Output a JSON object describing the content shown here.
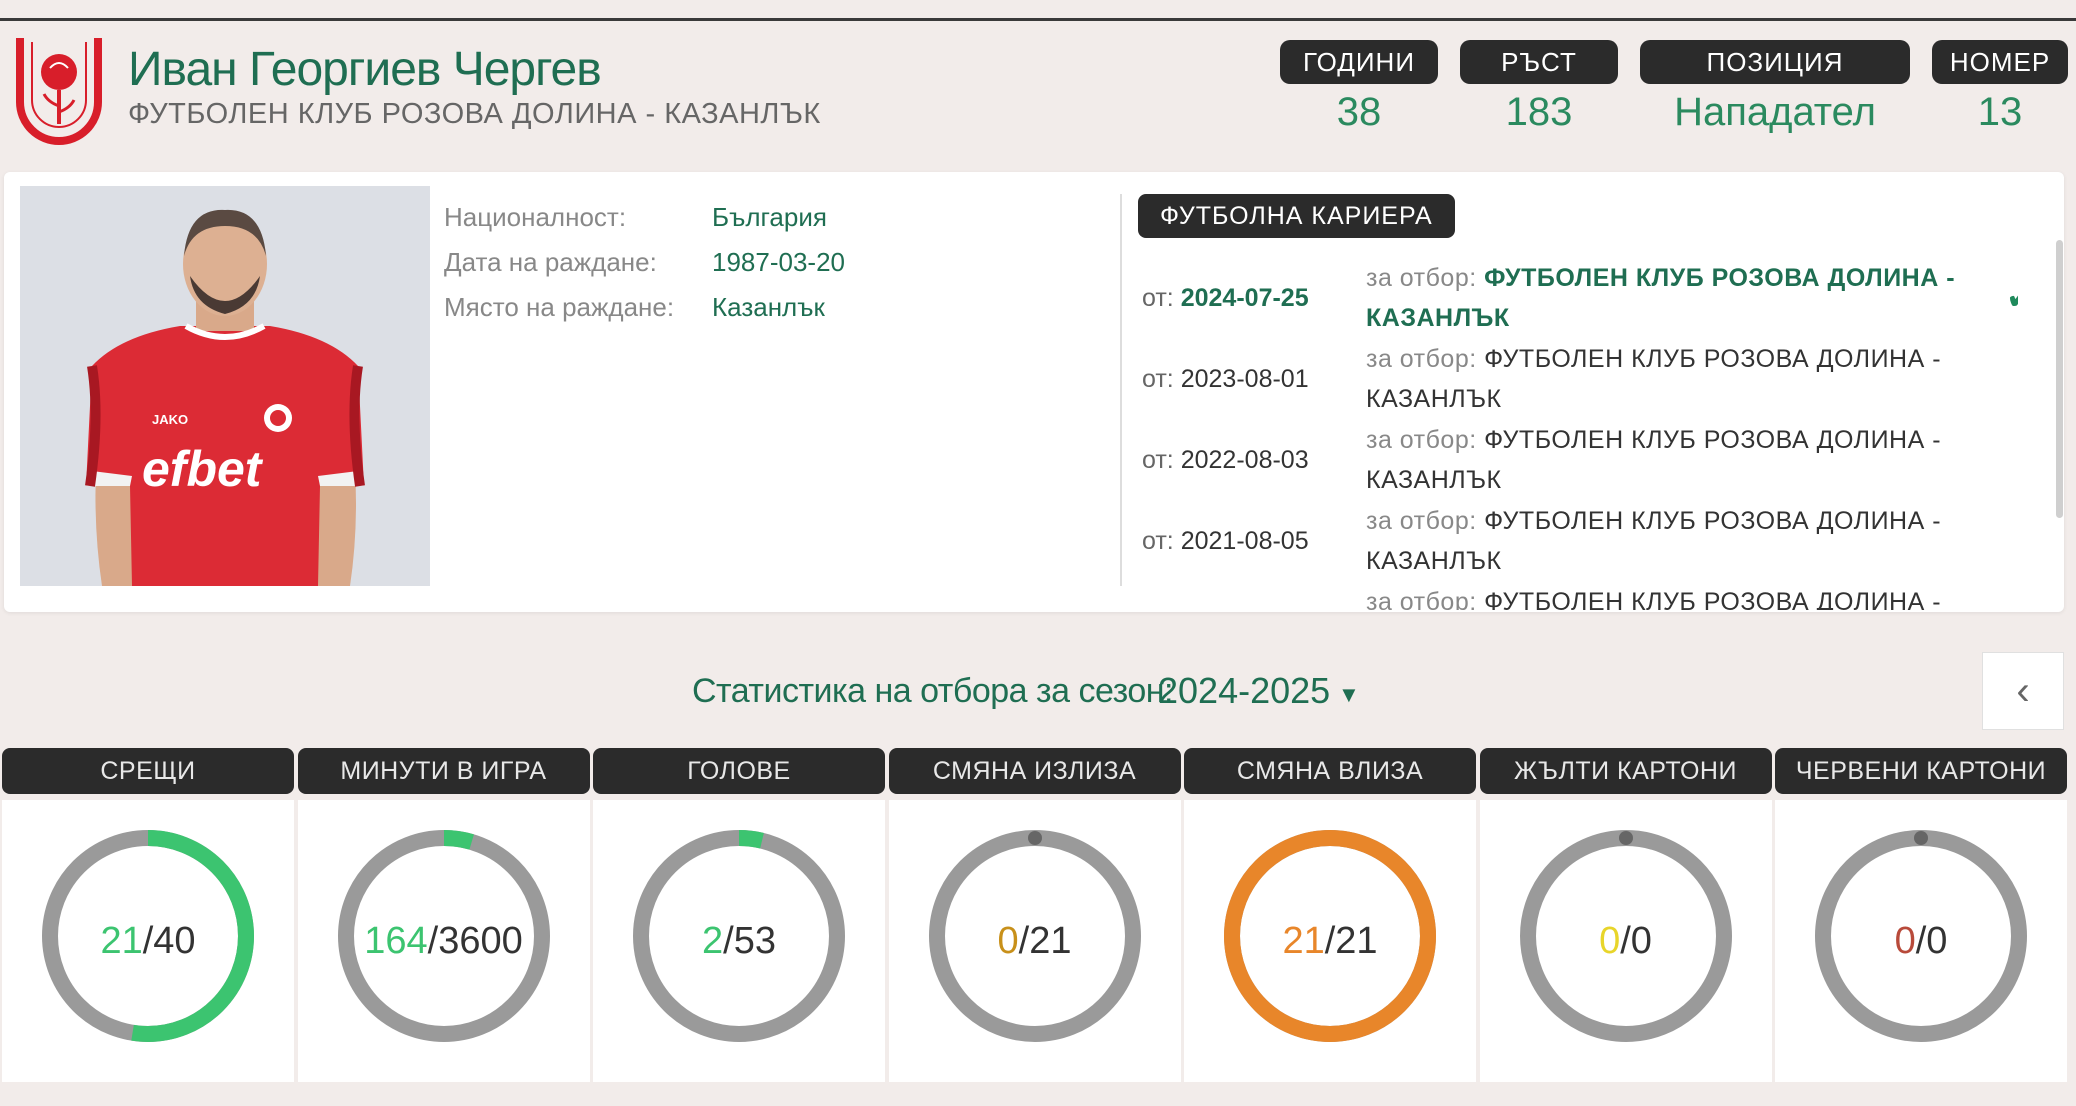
{
  "player": {
    "name": "Иван Георгиев Чергев",
    "club": "ФУТБОЛЕН КЛУБ РОЗОВА ДОЛИНА - КАЗАНЛЪК"
  },
  "info": [
    {
      "label": "ГОДИНИ",
      "value": "38"
    },
    {
      "label": "РЪСТ",
      "value": "183"
    },
    {
      "label": "ПОЗИЦИЯ",
      "value": "Нападател"
    },
    {
      "label": "НОМЕР",
      "value": "13"
    }
  ],
  "details": [
    {
      "label": "Националност:",
      "value": "България"
    },
    {
      "label": "Дата на раждане:",
      "value": "1987-03-20"
    },
    {
      "label": "Място на раждане:",
      "value": "Казанлък"
    }
  ],
  "photo": {
    "shirt_text": "efbet"
  },
  "career": {
    "title": "ФУТБОЛНА КАРИЕРА",
    "from_label": "от:",
    "team_label": "за отбор:",
    "entries": [
      {
        "date": "2024-07-25",
        "team": "ФУТБОЛЕН КЛУБ РОЗОВА ДОЛИНА - КАЗАНЛЪК",
        "current": true
      },
      {
        "date": "2023-08-01",
        "team": "ФУТБОЛЕН КЛУБ РОЗОВА ДОЛИНА - КАЗАНЛЪК",
        "current": false
      },
      {
        "date": "2022-08-03",
        "team": "ФУТБОЛЕН КЛУБ РОЗОВА ДОЛИНА - КАЗАНЛЪК",
        "current": false
      },
      {
        "date": "2021-08-05",
        "team": "ФУТБОЛЕН КЛУБ РОЗОВА ДОЛИНА - КАЗАНЛЪК",
        "current": false
      },
      {
        "date": "",
        "team": "ФУТБОЛЕН КЛУБ РОЗОВА ДОЛИНА -",
        "current": false
      }
    ]
  },
  "season": {
    "label": "Статистика на отбора за сезон:",
    "value": "2024-2025"
  },
  "stats": [
    {
      "label": "СРЕЩИ",
      "value": 21,
      "total": 40,
      "color": "#3cc470"
    },
    {
      "label": "МИНУТИ В ИГРА",
      "value": 164,
      "total": 3600,
      "color": "#3cc470"
    },
    {
      "label": "ГОЛОВЕ",
      "value": 2,
      "total": 53,
      "color": "#3cc470"
    },
    {
      "label": "СМЯНА ИЗЛИЗА",
      "value": 0,
      "total": 21,
      "color": "#c8901a"
    },
    {
      "label": "СМЯНА ВЛИЗА",
      "value": 21,
      "total": 21,
      "color": "#e8862a"
    },
    {
      "label": "ЖЪЛТИ КАРТОНИ",
      "value": 0,
      "total": 0,
      "color": "#e8d52a"
    },
    {
      "label": "ЧЕРВЕНИ КАРТОНИ",
      "value": 0,
      "total": 0,
      "color": "#b84a3a"
    }
  ],
  "colors": {
    "accent": "#1f6e52",
    "dark_header": "#2b2b2b",
    "ring_track": "#9a9a9a"
  }
}
